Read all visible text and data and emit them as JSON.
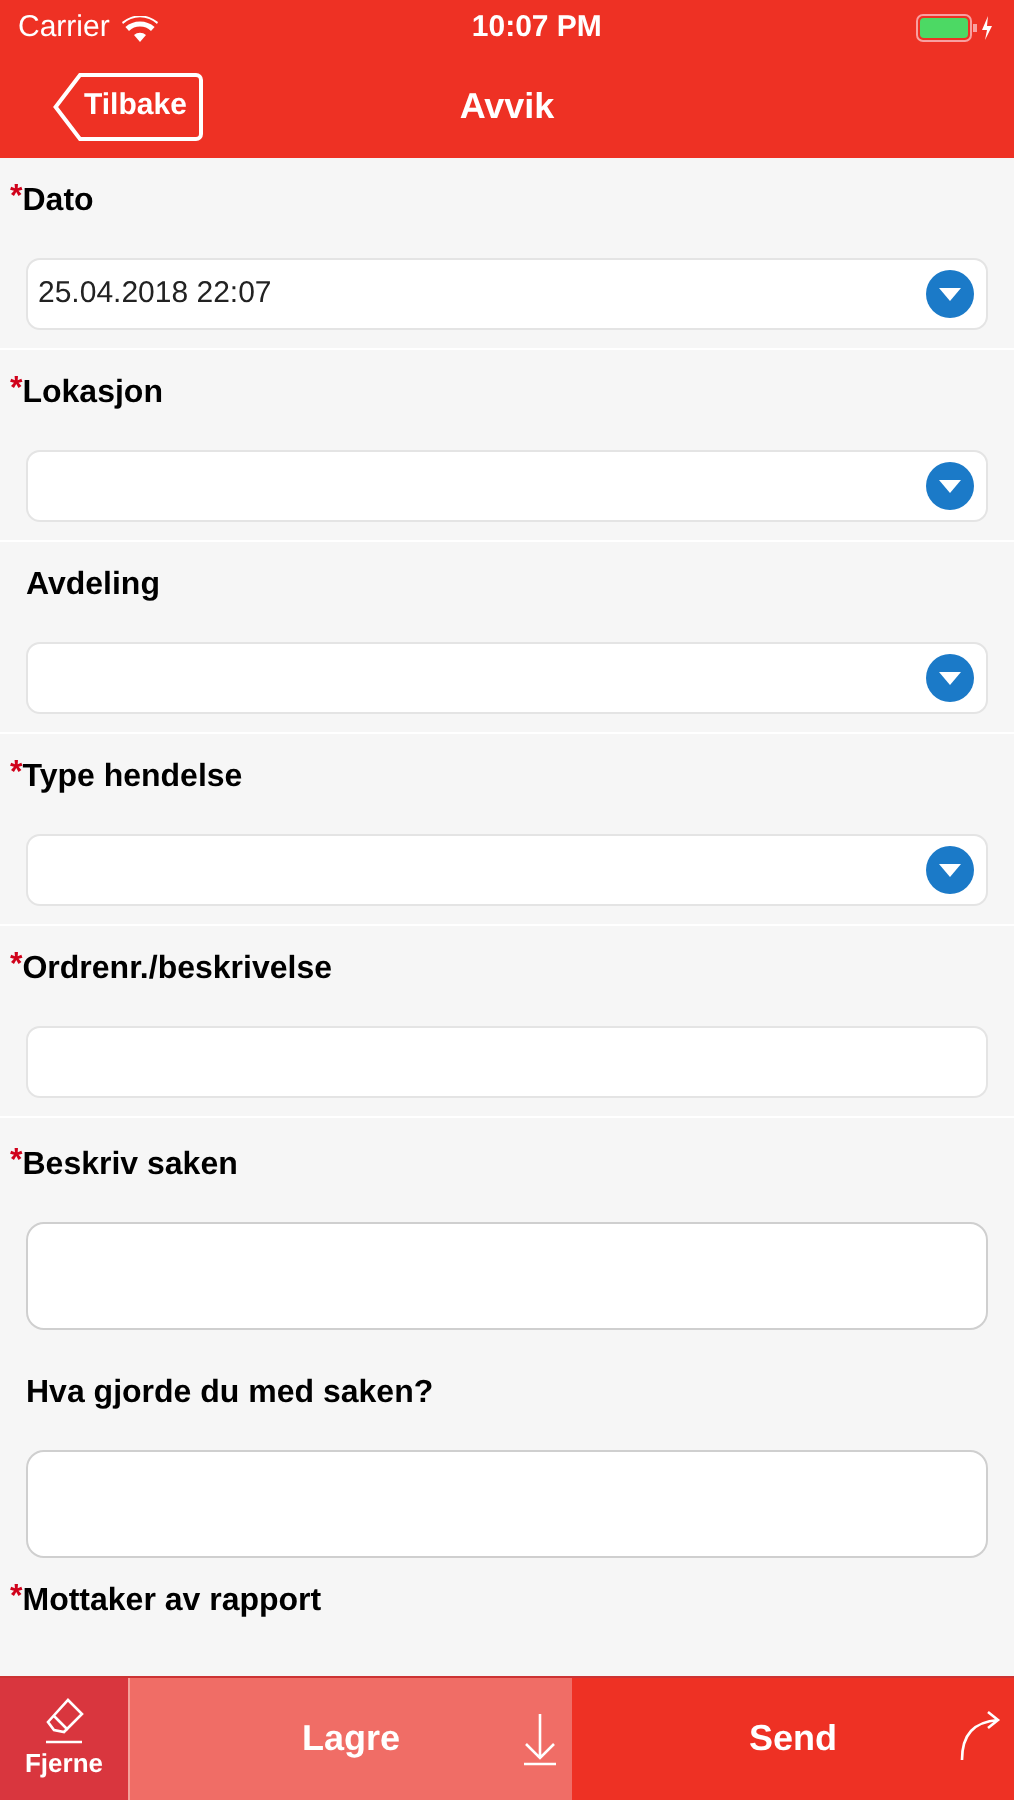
{
  "status_bar": {
    "carrier": "Carrier",
    "time": "10:07 PM"
  },
  "nav": {
    "back": "Tilbake",
    "title": "Avvik"
  },
  "fields": [
    {
      "label": "Dato",
      "mark": "*",
      "kind": "select",
      "value": "25.04.2018 22:07"
    },
    {
      "label": "Lokasjon",
      "mark": "*",
      "kind": "select"
    },
    {
      "label": "Avdeling",
      "kind": "select"
    },
    {
      "label": "Type hendelse",
      "mark": "*",
      "kind": "select"
    },
    {
      "label": "Ordrenr./beskrivelse",
      "mark": "*",
      "kind": "text"
    },
    {
      "label": "Beskriv saken",
      "mark": "*",
      "kind": "textarea"
    },
    {
      "label": "Hva gjorde du med saken?",
      "kind": "textarea"
    },
    {
      "label": "Mottaker av rapport",
      "mark": "*",
      "kind": "label"
    }
  ],
  "actions": {
    "clear": "Fjerne",
    "save": "Lagre",
    "send": "Send"
  }
}
